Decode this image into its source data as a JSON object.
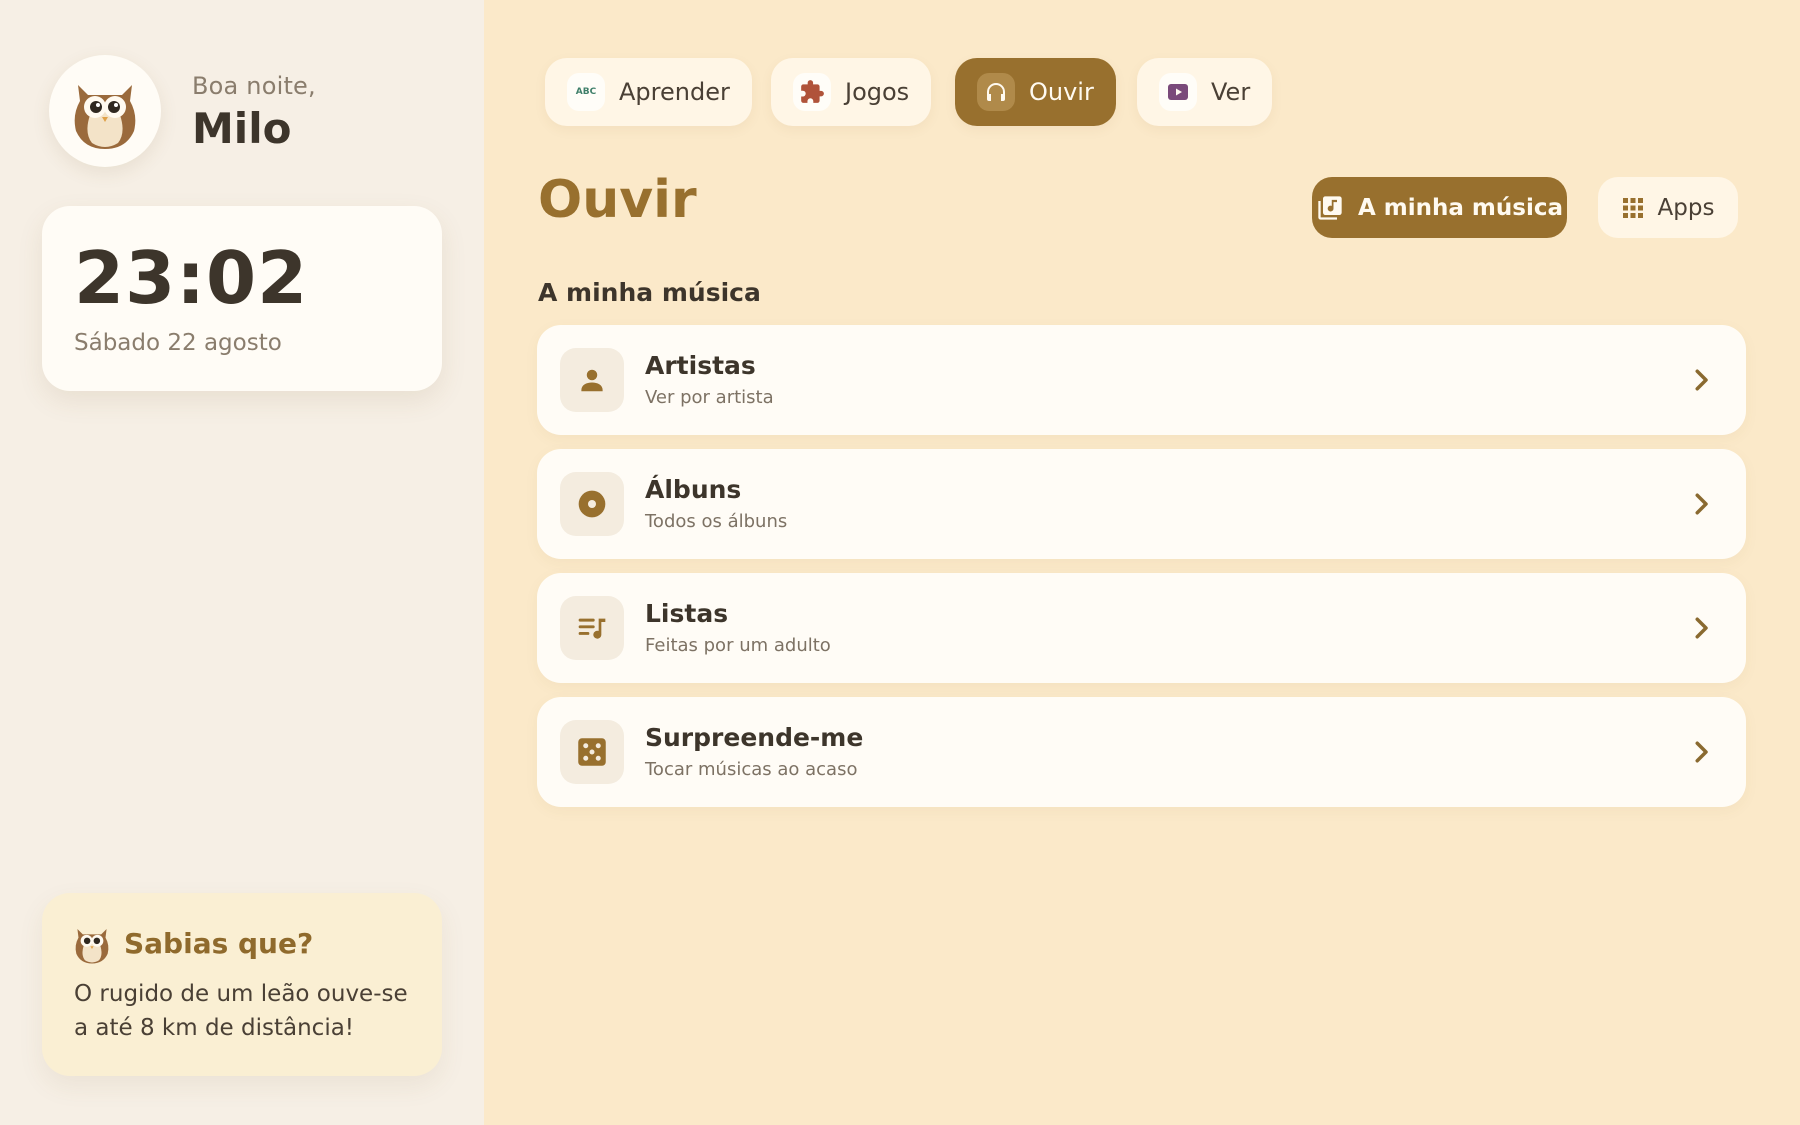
{
  "sidebar": {
    "greeting": "Boa noite,",
    "user_name": "Milo",
    "clock": {
      "time": "23:02",
      "date": "Sábado 22 agosto"
    },
    "fact": {
      "title": "Sabias que?",
      "text": "O rugido de um leão ouve-se a até 8 km de distância!"
    }
  },
  "nav": {
    "tabs": [
      {
        "label": "Aprender",
        "icon": "abc-icon",
        "active": false
      },
      {
        "label": "Jogos",
        "icon": "puzzle-icon",
        "active": false
      },
      {
        "label": "Ouvir",
        "icon": "headphones-icon",
        "active": true
      },
      {
        "label": "Ver",
        "icon": "play-icon",
        "active": false
      }
    ],
    "abc_glyph": "ABC"
  },
  "main": {
    "title": "Ouvir",
    "my_music_button": "A minha música",
    "apps_button": "Apps",
    "section_title": "A minha música",
    "items": [
      {
        "title": "Artistas",
        "subtitle": "Ver por artista",
        "icon": "person-icon"
      },
      {
        "title": "Álbuns",
        "subtitle": "Todos os álbuns",
        "icon": "disc-icon"
      },
      {
        "title": "Listas",
        "subtitle": "Feitas por um adulto",
        "icon": "playlist-icon"
      },
      {
        "title": "Surpreende-me",
        "subtitle": "Tocar músicas ao acaso",
        "icon": "dice-icon"
      }
    ]
  },
  "colors": {
    "accent": "#98702e",
    "background": "#fbe9c9",
    "sidebar": "#f6efe5",
    "card": "#fffcf6",
    "text": "#3d352b"
  }
}
